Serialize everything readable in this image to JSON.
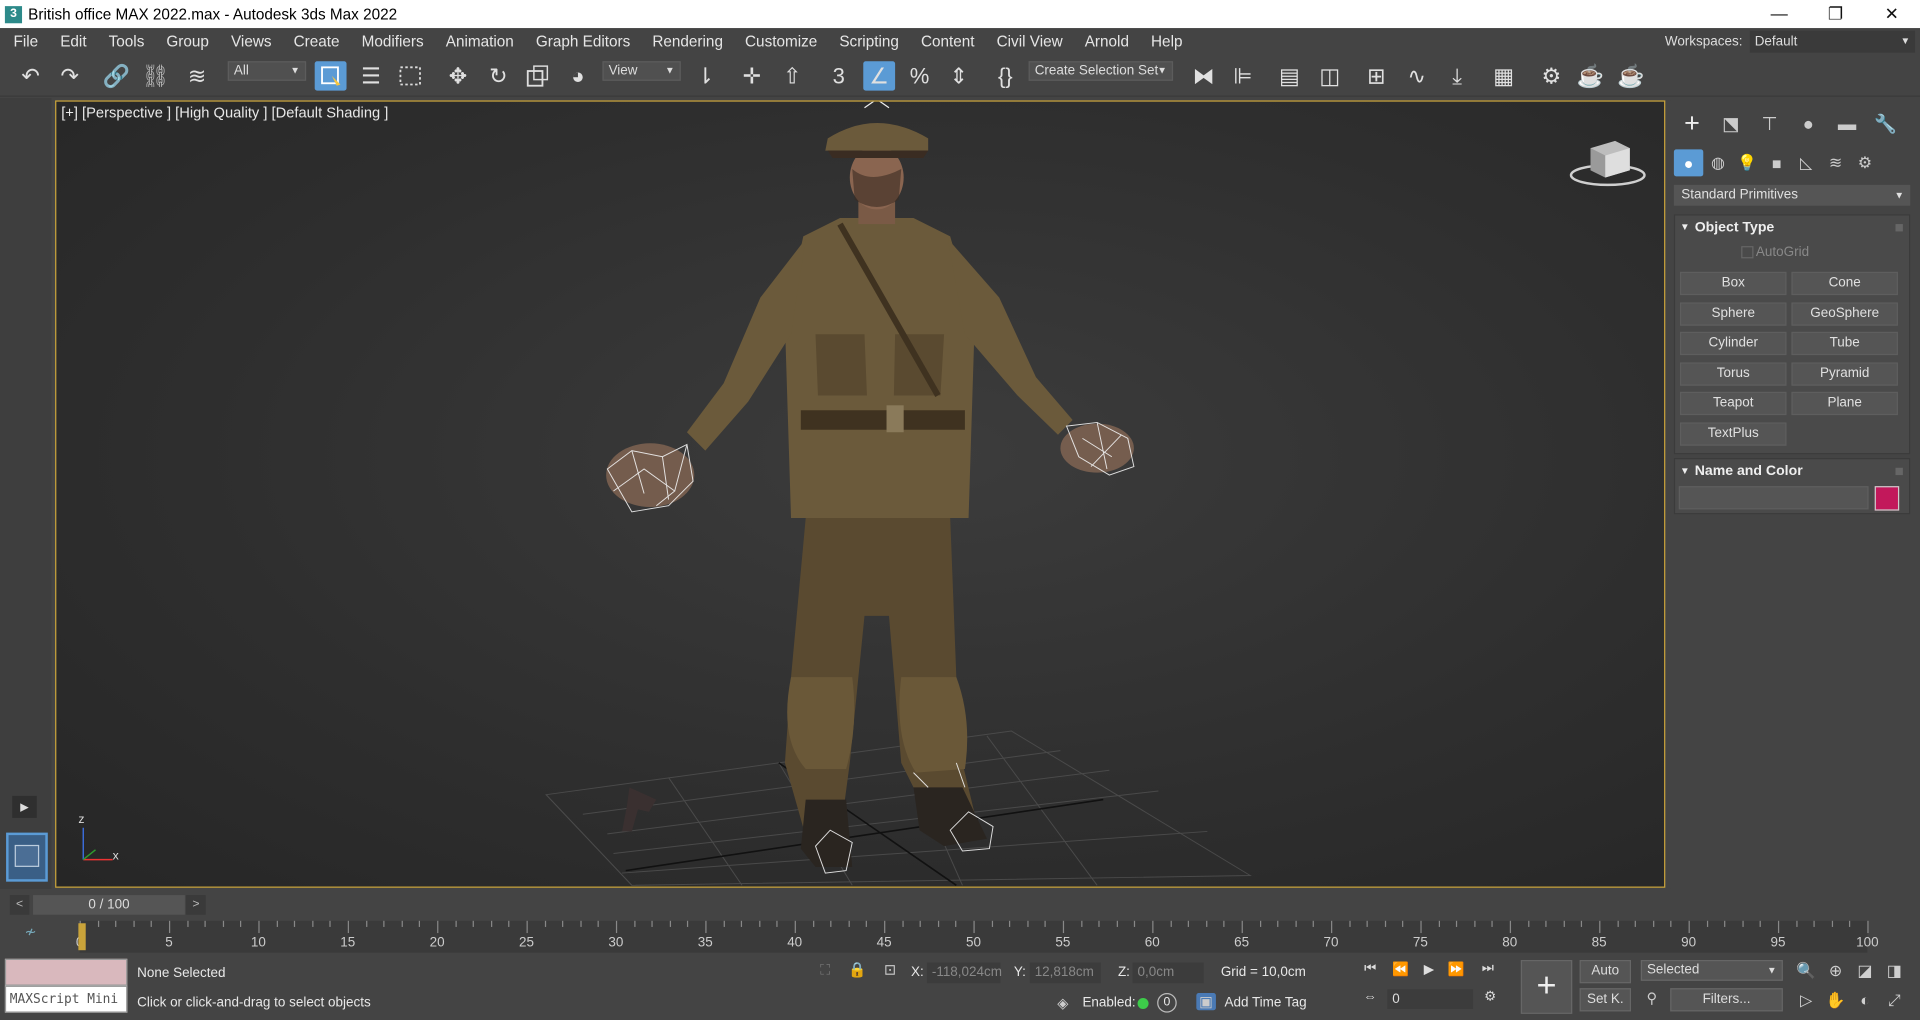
{
  "window": {
    "title": "British office MAX 2022.max - Autodesk 3ds Max 2022",
    "app_icon": "3",
    "minimize": "—",
    "restore": "❐",
    "close": "✕"
  },
  "menu": [
    "File",
    "Edit",
    "Tools",
    "Group",
    "Views",
    "Create",
    "Modifiers",
    "Animation",
    "Graph Editors",
    "Rendering",
    "Customize",
    "Scripting",
    "Content",
    "Civil View",
    "Arnold",
    "Help"
  ],
  "workspaces": {
    "label": "Workspaces:",
    "value": "Default"
  },
  "toolbar": {
    "filter_dropdown": "All",
    "coord_dropdown": "View",
    "selection_set": "Create Selection Set"
  },
  "viewport": {
    "label": "[+] [Perspective ] [High Quality ] [Default Shading ]",
    "axis_x": "x",
    "axis_z": "z"
  },
  "command_panel": {
    "category": "Standard Primitives",
    "object_type_title": "Object Type",
    "autogrid": "AutoGrid",
    "buttons": [
      "Box",
      "Cone",
      "Sphere",
      "GeoSphere",
      "Cylinder",
      "Tube",
      "Torus",
      "Pyramid",
      "Teapot",
      "Plane",
      "TextPlus"
    ],
    "name_color_title": "Name and Color",
    "color": "#c2185b"
  },
  "timeslider": {
    "frame_readout": "0 / 100",
    "prev": "<",
    "next": ">"
  },
  "trackbar": {
    "labels": [
      "0",
      "5",
      "10",
      "15",
      "20",
      "25",
      "30",
      "35",
      "40",
      "45",
      "50",
      "55",
      "60",
      "65",
      "70",
      "75",
      "80",
      "85",
      "90",
      "95",
      "100"
    ]
  },
  "status": {
    "maxscript_label": "MAXScript Mini",
    "selection": "None Selected",
    "prompt": "Click or click-and-drag to select objects",
    "x_label": "X:",
    "x_value": "-118,024cm",
    "y_label": "Y:",
    "y_value": "12,818cm",
    "z_label": "Z:",
    "z_value": "0,0cm",
    "grid": "Grid = 10,0cm",
    "enabled_label": "Enabled:",
    "enabled_count": "0",
    "add_time_tag": "Add Time Tag",
    "auto_key": "Auto",
    "set_key": "Set K.",
    "selected_dropdown": "Selected",
    "filters": "Filters...",
    "frame_value": "0"
  }
}
